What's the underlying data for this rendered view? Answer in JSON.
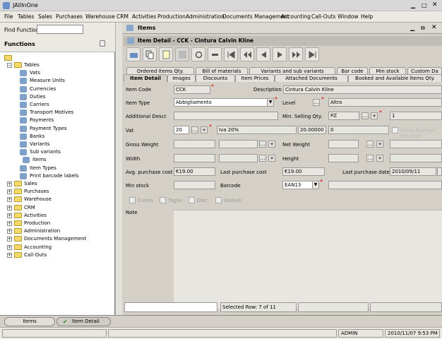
{
  "window": {
    "title": "JAllInOne"
  },
  "menu": [
    "File",
    "Tables",
    "Sales",
    "Purchases",
    "Warehouse",
    "CRM",
    "Activities",
    "Production",
    "Administration",
    "Documents Management",
    "Accounting",
    "Call-Outs",
    "Window",
    "Help"
  ],
  "left": {
    "find_label": "Find Function",
    "find_value": "",
    "functions_label": "Functions",
    "tree": [
      {
        "label": "Tables",
        "type": "folder",
        "depth": 1,
        "expanded": true
      },
      {
        "label": "Vats",
        "type": "leaf",
        "depth": 2
      },
      {
        "label": "Measure Units",
        "type": "leaf",
        "depth": 2
      },
      {
        "label": "Currencies",
        "type": "leaf",
        "depth": 2
      },
      {
        "label": "Duties",
        "type": "leaf",
        "depth": 2
      },
      {
        "label": "Carriers",
        "type": "leaf",
        "depth": 2
      },
      {
        "label": "Transport Motives",
        "type": "leaf",
        "depth": 2
      },
      {
        "label": "Payments",
        "type": "leaf",
        "depth": 2
      },
      {
        "label": "Payment Types",
        "type": "leaf",
        "depth": 2
      },
      {
        "label": "Banks",
        "type": "leaf",
        "depth": 2
      },
      {
        "label": "Variants",
        "type": "leaf",
        "depth": 2
      },
      {
        "label": "Sub variants",
        "type": "leaf",
        "depth": 2
      },
      {
        "label": "Items",
        "type": "leaf",
        "depth": 3
      },
      {
        "label": "Item Types",
        "type": "leaf",
        "depth": 2
      },
      {
        "label": "Print barcode labels",
        "type": "leaf",
        "depth": 2
      },
      {
        "label": "Sales",
        "type": "folder",
        "depth": 1
      },
      {
        "label": "Purchases",
        "type": "folder",
        "depth": 1
      },
      {
        "label": "Warehouse",
        "type": "folder",
        "depth": 1
      },
      {
        "label": "CRM",
        "type": "folder",
        "depth": 1
      },
      {
        "label": "Activities",
        "type": "folder",
        "depth": 1
      },
      {
        "label": "Production",
        "type": "folder",
        "depth": 1
      },
      {
        "label": "Administration",
        "type": "folder",
        "depth": 1
      },
      {
        "label": "Documents Management",
        "type": "folder",
        "depth": 1
      },
      {
        "label": "Accounting",
        "type": "folder",
        "depth": 1
      },
      {
        "label": "Call-Outs",
        "type": "folder",
        "depth": 1
      }
    ]
  },
  "items_frame": {
    "title": "Items"
  },
  "detail_frame": {
    "title": "Item Detail - CCK - Cintura Calvin Kline"
  },
  "tabs_row1": [
    "Ordered Items Qty.",
    "Bill of materials",
    "Variants and sub variants",
    "Bar code",
    "Min stock",
    "Custom Da"
  ],
  "tabs_row2": [
    "Item Detail",
    "Images",
    "Discounts",
    "Item Prices",
    "Attached Documents",
    "Booked and Available Items Qty."
  ],
  "form": {
    "item_code_label": "Item Code",
    "item_code": "CCK",
    "description_label": "Description",
    "description": "Cintura Calvin Kline",
    "item_type_label": "Item Type",
    "item_type": "Abbigliamento",
    "level_label": "Level",
    "level": "Altro",
    "additional_label": "Additional Descr.",
    "additional": "",
    "min_sell_label": "Min. Selling Qty.",
    "min_sell_um": "PZ",
    "min_sell_qty": "1",
    "vat_label": "Vat",
    "vat_code": "20",
    "vat_desc": "Iva 20%",
    "vat_value": "20.00000",
    "vat_deductible": "0",
    "serial_label": "Serial Number required",
    "gross_weight_label": "Gross Weight",
    "net_weight_label": "Net Weight",
    "width_label": "Width",
    "height_label": "Height",
    "avg_cost_label": "Avg. purchase cost",
    "avg_cost": "€19.00",
    "last_cost_label": "Last purchase cost",
    "last_cost": "€19.00",
    "last_date_label": "Last purchase date",
    "last_date": "2010/09/11",
    "min_stock_label": "Min stock",
    "barcode_label": "Barcode",
    "barcode": "EAN13",
    "checks": [
      "Colors",
      "Taglie",
      "Disc.",
      "Stelure"
    ],
    "note_label": "Note"
  },
  "bottom": {
    "selected_row": "Selected Row: 7 of 11"
  },
  "taskbar": [
    {
      "label": "Items"
    },
    {
      "label": "Item Detail"
    }
  ],
  "status": {
    "user": "ADMIN",
    "datetime": "2010/11/07 9:53 PM"
  }
}
